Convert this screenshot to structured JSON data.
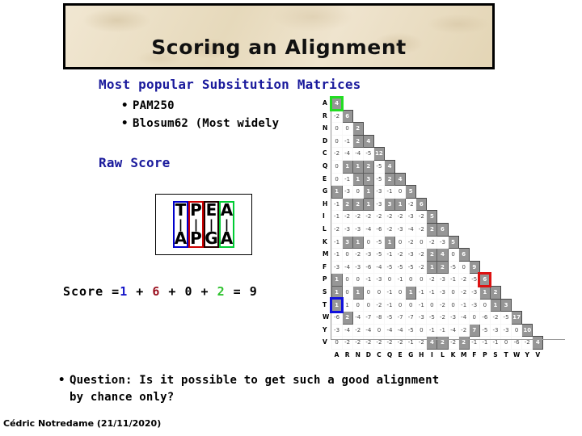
{
  "slide": {
    "title": "Scoring an Alignment",
    "subhead_matrices": "Most popular Subsitution Matrices",
    "bullets": [
      "PAM250",
      "Blosum62 (Most widely "
    ],
    "rawscore_head": "Raw Score",
    "question_line1": "Question: Is it possible to get such a good alignment",
    "question_line2": "by chance only?",
    "footer": "Cédric Notredame (21/11/2020)",
    "bullet_glyph": "•"
  },
  "alignment": {
    "top_sequence": [
      "T",
      "P",
      "E",
      "A"
    ],
    "match_bars": [
      "|",
      "|",
      "|",
      "|"
    ],
    "bottom_sequence": [
      "A",
      "P",
      "G",
      "A"
    ],
    "column_colors": [
      "#0000cc",
      "#cc0000",
      "#220000",
      "#00cc33"
    ]
  },
  "score": {
    "prefix": "Score =",
    "terms": [
      {
        "value": "1",
        "color": "#1414c8"
      },
      {
        "value": "6",
        "color": "#9a0f1e"
      },
      {
        "value": "0",
        "color": "#000000"
      },
      {
        "value": "2",
        "color": "#2fc22f"
      }
    ],
    "plus": "+",
    "equals": "=",
    "total": "9"
  },
  "colors": {
    "banner_bg": "#e9ddc2",
    "heading_blue": "#1a1a9c",
    "highlight_green": "#22dd22",
    "highlight_red": "#dd1111",
    "highlight_blue": "#1111dd",
    "highlight_black": "#000000",
    "matrix_cell_fill": "#969696"
  },
  "chart_data": {
    "type": "heatmap",
    "title": "BLOSUM62 substitution matrix (lower triangle)",
    "xlabel": "",
    "ylabel": "",
    "legend": [],
    "row_labels": [
      "A",
      "R",
      "N",
      "D",
      "C",
      "Q",
      "E",
      "G",
      "H",
      "I",
      "L",
      "K",
      "M",
      "F",
      "P",
      "S",
      "T",
      "W",
      "Y",
      "V"
    ],
    "col_labels": [
      "A",
      "R",
      "N",
      "D",
      "C",
      "Q",
      "E",
      "G",
      "H",
      "I",
      "L",
      "K",
      "M",
      "F",
      "P",
      "S",
      "T",
      "W",
      "Y",
      "V"
    ],
    "rows": [
      [
        4
      ],
      [
        -2,
        6
      ],
      [
        0,
        0,
        2
      ],
      [
        0,
        -1,
        2,
        4
      ],
      [
        -2,
        -4,
        -4,
        -5,
        12
      ],
      [
        0,
        1,
        1,
        2,
        -5,
        4
      ],
      [
        0,
        -1,
        1,
        3,
        -5,
        2,
        4
      ],
      [
        1,
        -3,
        0,
        1,
        -3,
        -1,
        0,
        5
      ],
      [
        -1,
        2,
        2,
        1,
        -3,
        3,
        1,
        -2,
        6
      ],
      [
        -1,
        -2,
        -2,
        -2,
        -2,
        -2,
        -2,
        -3,
        -2,
        5
      ],
      [
        -2,
        -3,
        -3,
        -4,
        -6,
        -2,
        -3,
        -4,
        -2,
        2,
        6
      ],
      [
        -1,
        3,
        1,
        0,
        -5,
        1,
        0,
        -2,
        0,
        -2,
        -3,
        5
      ],
      [
        -1,
        0,
        -2,
        -3,
        -5,
        -1,
        -2,
        -3,
        -2,
        2,
        4,
        0,
        6
      ],
      [
        -3,
        -4,
        -3,
        -6,
        -4,
        -5,
        -5,
        -5,
        -2,
        1,
        2,
        -5,
        0,
        9
      ],
      [
        1,
        0,
        0,
        -1,
        -3,
        0,
        -1,
        0,
        0,
        -2,
        -3,
        -1,
        -2,
        -5,
        6
      ],
      [
        1,
        0,
        1,
        0,
        0,
        -1,
        0,
        1,
        -1,
        -1,
        -3,
        0,
        -2,
        -3,
        1,
        2
      ],
      [
        1,
        1,
        0,
        0,
        -2,
        -1,
        0,
        0,
        -1,
        0,
        -2,
        0,
        -1,
        -3,
        0,
        1,
        3
      ],
      [
        -6,
        2,
        -4,
        -7,
        -8,
        -5,
        -7,
        -7,
        -3,
        -5,
        -2,
        -3,
        -4,
        0,
        -6,
        -2,
        -5,
        17
      ],
      [
        -3,
        -4,
        -2,
        -4,
        0,
        -4,
        -4,
        -5,
        0,
        -1,
        -1,
        -4,
        -2,
        7,
        -5,
        -3,
        -3,
        0,
        10
      ],
      [
        0,
        -2,
        -2,
        -2,
        -2,
        -2,
        -2,
        -1,
        -2,
        4,
        2,
        -2,
        2,
        -1,
        -1,
        -1,
        0,
        -6,
        -2,
        4
      ]
    ],
    "highlighted_cells": [
      {
        "row": "A",
        "col": "A",
        "value": 4,
        "mark": "green"
      },
      {
        "row": "E",
        "col": "G",
        "value": 0,
        "mark": "black"
      },
      {
        "row": "P",
        "col": "P",
        "value": 6,
        "mark": "red"
      },
      {
        "row": "T",
        "col": "A",
        "value": 1,
        "mark": "blue"
      }
    ],
    "shaded_cells": [
      {
        "row": "A",
        "cols": [
          "A"
        ]
      },
      {
        "row": "R",
        "cols": [
          "R"
        ]
      },
      {
        "row": "N",
        "cols": [
          "N"
        ]
      },
      {
        "row": "D",
        "cols": [
          "N",
          "D"
        ]
      },
      {
        "row": "C",
        "cols": [
          "C"
        ]
      },
      {
        "row": "Q",
        "cols": [
          "R",
          "N",
          "D",
          "Q"
        ]
      },
      {
        "row": "E",
        "cols": [
          "N",
          "D",
          "Q",
          "E"
        ]
      },
      {
        "row": "G",
        "cols": [
          "A",
          "D",
          "G"
        ]
      },
      {
        "row": "H",
        "cols": [
          "R",
          "N",
          "D",
          "Q",
          "E",
          "H"
        ]
      },
      {
        "row": "I",
        "cols": [
          "I"
        ]
      },
      {
        "row": "L",
        "cols": [
          "I",
          "L"
        ]
      },
      {
        "row": "K",
        "cols": [
          "R",
          "N",
          "Q",
          "K"
        ]
      },
      {
        "row": "M",
        "cols": [
          "I",
          "L",
          "M"
        ]
      },
      {
        "row": "F",
        "cols": [
          "I",
          "L",
          "F"
        ]
      },
      {
        "row": "P",
        "cols": [
          "A",
          "P"
        ]
      },
      {
        "row": "S",
        "cols": [
          "A",
          "N",
          "G",
          "P",
          "S"
        ]
      },
      {
        "row": "T",
        "cols": [
          "A",
          "S",
          "T"
        ]
      },
      {
        "row": "W",
        "cols": [
          "R",
          "W"
        ]
      },
      {
        "row": "Y",
        "cols": [
          "F",
          "Y"
        ]
      },
      {
        "row": "V",
        "cols": [
          "I",
          "L",
          "M",
          "V"
        ]
      }
    ],
    "grid": false,
    "legend_position": "none"
  }
}
